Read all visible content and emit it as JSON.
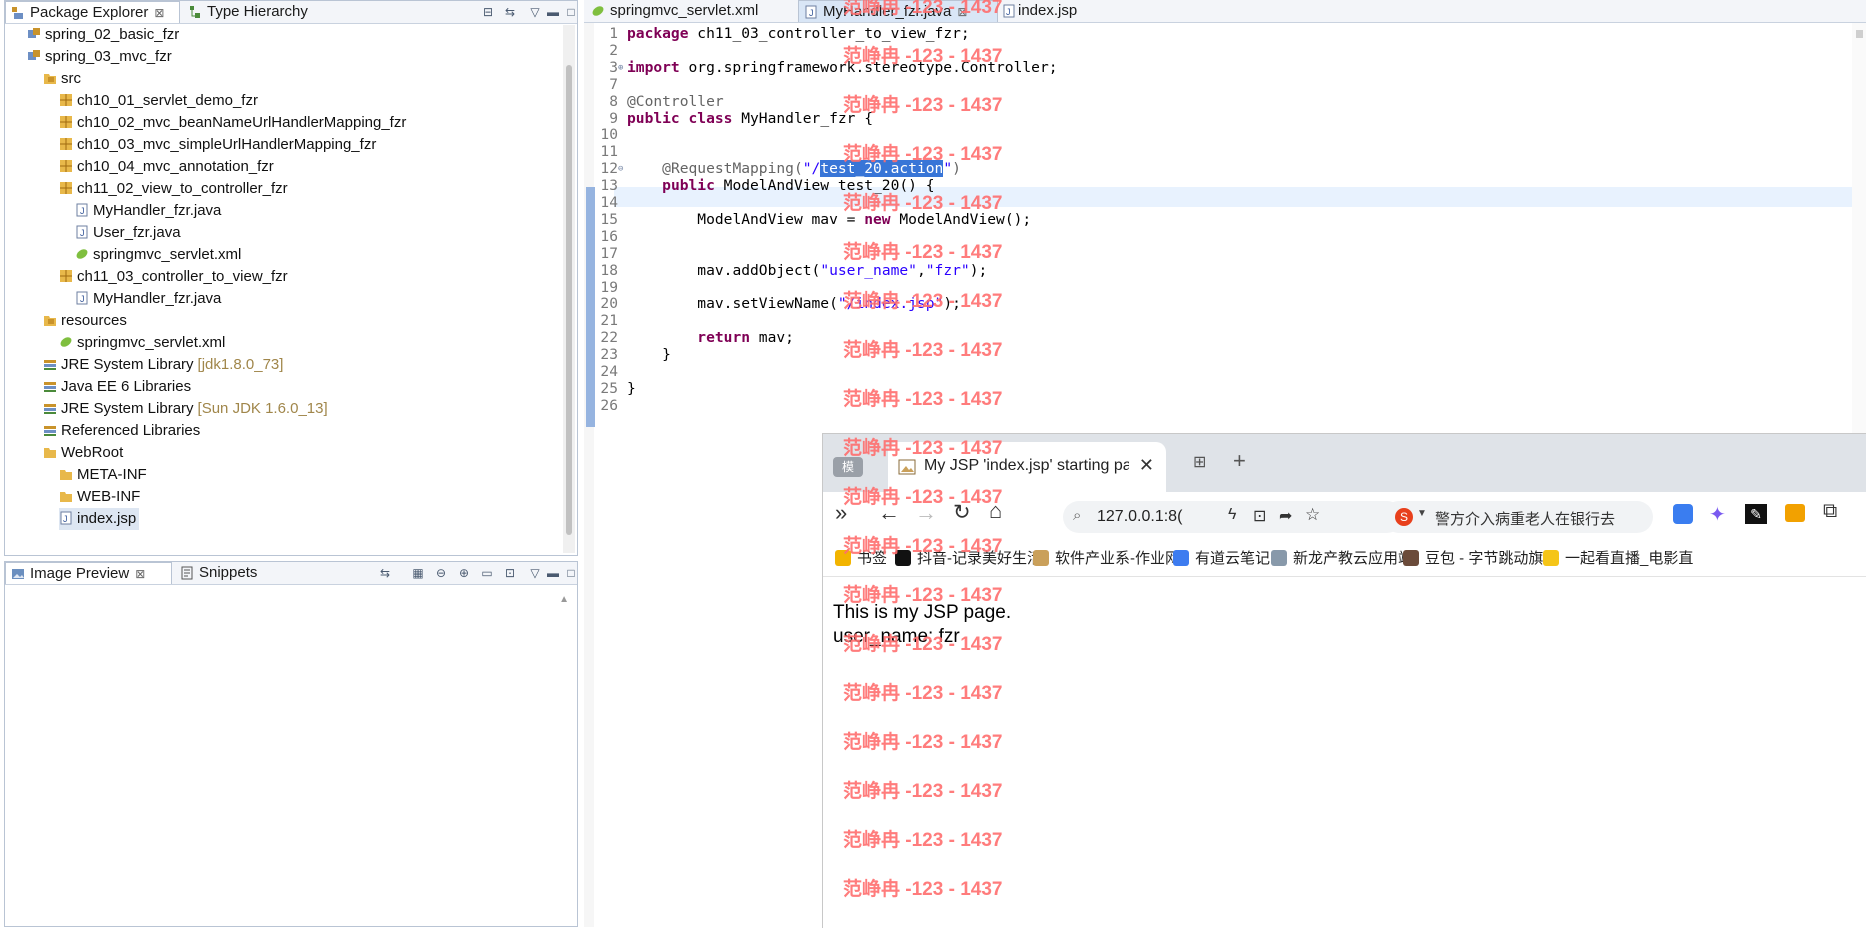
{
  "package_explorer": {
    "tabs": [
      {
        "label": "Package Explorer"
      },
      {
        "label": "Type Hierarchy"
      }
    ],
    "tree": [
      {
        "label": "spring_02_basic_fzr",
        "icon": "java-project-icon"
      },
      {
        "label": "spring_03_mvc_fzr",
        "icon": "java-project-icon"
      },
      {
        "label": "src",
        "icon": "source-folder-icon"
      },
      {
        "label": "ch10_01_servlet_demo_fzr",
        "icon": "package-icon"
      },
      {
        "label": "ch10_02_mvc_beanNameUrlHandlerMapping_fzr",
        "icon": "package-icon"
      },
      {
        "label": "ch10_03_mvc_simpleUrlHandlerMapping_fzr",
        "icon": "package-icon"
      },
      {
        "label": "ch10_04_mvc_annotation_fzr",
        "icon": "package-icon"
      },
      {
        "label": "ch11_02_view_to_controller_fzr",
        "icon": "package-icon"
      },
      {
        "label": "MyHandler_fzr.java",
        "icon": "java-file-icon"
      },
      {
        "label": "User_fzr.java",
        "icon": "java-file-icon"
      },
      {
        "label": "springmvc_servlet.xml",
        "icon": "spring-xml-icon"
      },
      {
        "label": "ch11_03_controller_to_view_fzr",
        "icon": "package-icon"
      },
      {
        "label": "MyHandler_fzr.java",
        "icon": "java-file-icon"
      },
      {
        "label": "resources",
        "icon": "source-folder-icon"
      },
      {
        "label": "springmvc_servlet.xml",
        "icon": "spring-xml-icon"
      },
      {
        "label": "JRE System Library",
        "suffix": "[jdk1.8.0_73]",
        "icon": "library-icon"
      },
      {
        "label": "Java EE 6 Libraries",
        "icon": "library-icon"
      },
      {
        "label": "JRE System Library",
        "suffix": "[Sun JDK 1.6.0_13]",
        "icon": "library-icon"
      },
      {
        "label": "Referenced Libraries",
        "icon": "library-icon"
      },
      {
        "label": "WebRoot",
        "icon": "folder-icon"
      },
      {
        "label": "META-INF",
        "icon": "folder-icon"
      },
      {
        "label": "WEB-INF",
        "icon": "folder-icon"
      },
      {
        "label": "index.jsp",
        "icon": "jsp-file-icon",
        "selected": true
      }
    ]
  },
  "image_preview": {
    "tabs": [
      {
        "label": "Image Preview"
      },
      {
        "label": "Snippets"
      }
    ]
  },
  "editor": {
    "tabs": [
      {
        "label": "springmvc_servlet.xml"
      },
      {
        "label": "MyHandler_fzr.java",
        "active": true
      },
      {
        "label": "index.jsp"
      }
    ],
    "lines": [
      {
        "n": "1"
      },
      {
        "n": "2"
      },
      {
        "n": "3",
        "marker": "⊕"
      },
      {
        "n": "7"
      },
      {
        "n": "8"
      },
      {
        "n": "9"
      },
      {
        "n": "10"
      },
      {
        "n": "11"
      },
      {
        "n": "12",
        "marker": "⊖"
      },
      {
        "n": "13"
      },
      {
        "n": "14"
      },
      {
        "n": "15"
      },
      {
        "n": "16"
      },
      {
        "n": "17"
      },
      {
        "n": "18"
      },
      {
        "n": "19"
      },
      {
        "n": "20"
      },
      {
        "n": "21"
      },
      {
        "n": "22"
      },
      {
        "n": "23"
      },
      {
        "n": "24"
      },
      {
        "n": "25"
      },
      {
        "n": "26"
      }
    ],
    "code": {
      "l1_kw": "package",
      "l1_rest": " ch11_03_controller_to_view_fzr;",
      "l3_kw": "import",
      "l3_rest": " org.springframework.stereotype.Controller;",
      "l8": "@Controller",
      "l9_kw1": "public",
      "l9_kw2": "class",
      "l9_rest": " MyHandler_fzr {",
      "l12_ann": "@RequestMapping(",
      "l12_q1": "\"/",
      "l12_sel": "test_20.action",
      "l12_q2": "\"",
      "l12_end": ")",
      "l13_kw": "public",
      "l13_rest": " ModelAndView test_20() {",
      "l15_a": "ModelAndView mav = ",
      "l15_kw": "new",
      "l15_b": " ModelAndView();",
      "l18_a": "mav.addObject(",
      "l18_s1": "\"user_name\"",
      "l18_c": ",",
      "l18_s2": "\"fzr\"",
      "l18_b": ");",
      "l20_a": "mav.setViewName(",
      "l20_s": "\"/index.jsp\"",
      "l20_b": ");",
      "l22_kw": "return",
      "l22_rest": " mav;",
      "l23": "}",
      "l25": "}"
    }
  },
  "browser": {
    "tab_title": "My JSP 'index.jsp' starting pa",
    "tab_mode": "模",
    "url": "127.0.0.1:8(",
    "search_text": "警方介入病重老人在银行去",
    "bookmarks": [
      {
        "label": "书签",
        "icon": "star-icon",
        "color": "#f2b400"
      },
      {
        "label": "抖音-记录美好生活",
        "icon": "douyin-icon",
        "color": "#111111"
      },
      {
        "label": "软件产业系-作业网",
        "icon": "picture-icon",
        "color": "#caa05a"
      },
      {
        "label": "有道云笔记",
        "icon": "note-icon",
        "color": "#3d7cf0"
      },
      {
        "label": "新龙产教云应用端",
        "icon": "cloud-icon",
        "color": "#8899aa"
      },
      {
        "label": "豆包 - 字节跳动旗",
        "icon": "avatar-icon",
        "color": "#6b4b3a"
      },
      {
        "label": "一起看直播_电影直",
        "icon": "emoji-icon",
        "color": "#f5c518"
      }
    ],
    "page_lines": [
      "This is my JSP page.",
      "user_name: fzr"
    ]
  },
  "watermark": {
    "text": "范峥冉 -123 - 1437",
    "color": "#ff6e6e",
    "count": 19
  }
}
